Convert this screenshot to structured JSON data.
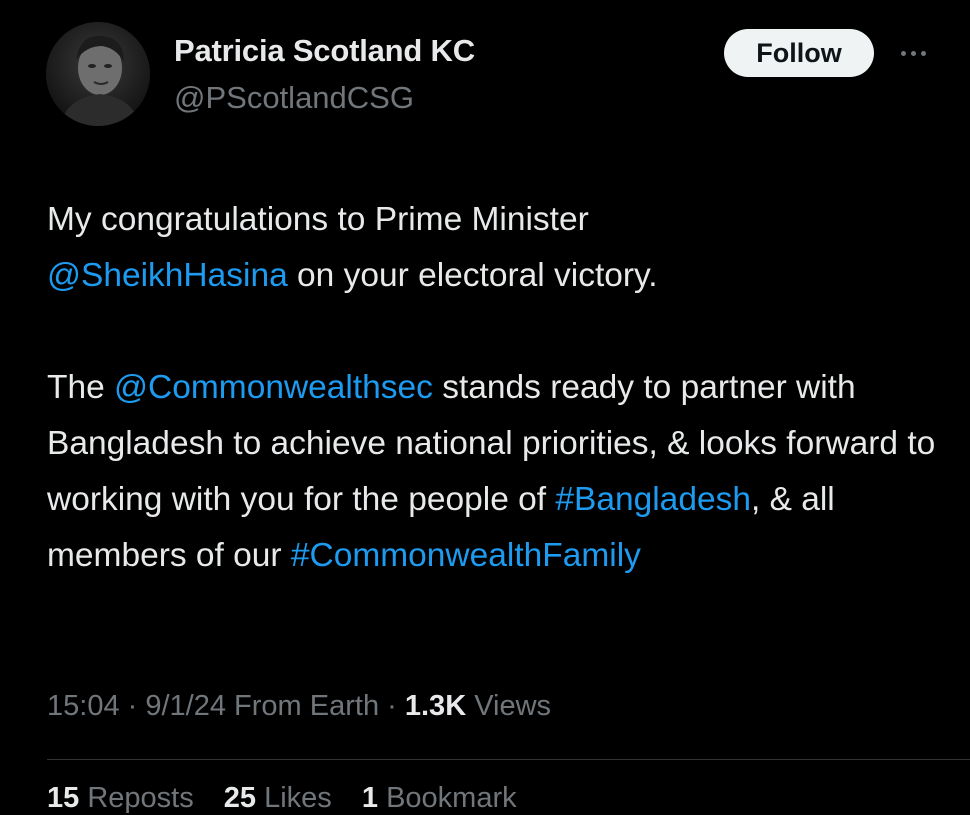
{
  "author": {
    "display_name": "Patricia Scotland KC",
    "handle": "@PScotlandCSG",
    "avatar_icon": "profile-photo"
  },
  "actions": {
    "follow_label": "Follow",
    "more_icon": "more-horizontal-icon"
  },
  "tweet": {
    "p1_text_a": "My congratulations to Prime Minister",
    "p1_mention": "@SheikhHasina",
    "p1_text_b": " on your electoral victory.",
    "p2_text_a": "The ",
    "p2_mention": "@Commonwealthsec",
    "p2_text_b": " stands ready to partner with Bangladesh to achieve national priorities, & looks forward to working with you for the people of ",
    "p2_hashtag1": "#Bangladesh",
    "p2_text_c": ", & all members of our ",
    "p2_hashtag2": "#CommonwealthFamily"
  },
  "meta": {
    "time": "15:04",
    "sep1": " · ",
    "date": "9/1/24",
    "source": " From Earth",
    "sep2": " · ",
    "views_count": "1.3K",
    "views_label": " Views"
  },
  "stats": {
    "reposts_count": "15",
    "reposts_label": " Reposts",
    "likes_count": "25",
    "likes_label": " Likes",
    "bookmarks_count": "1",
    "bookmarks_label": " Bookmark"
  },
  "colors": {
    "background": "#000000",
    "text": "#e7e9ea",
    "secondary": "#71767b",
    "link": "#1d9bf0",
    "follow_bg": "#eff3f4"
  }
}
